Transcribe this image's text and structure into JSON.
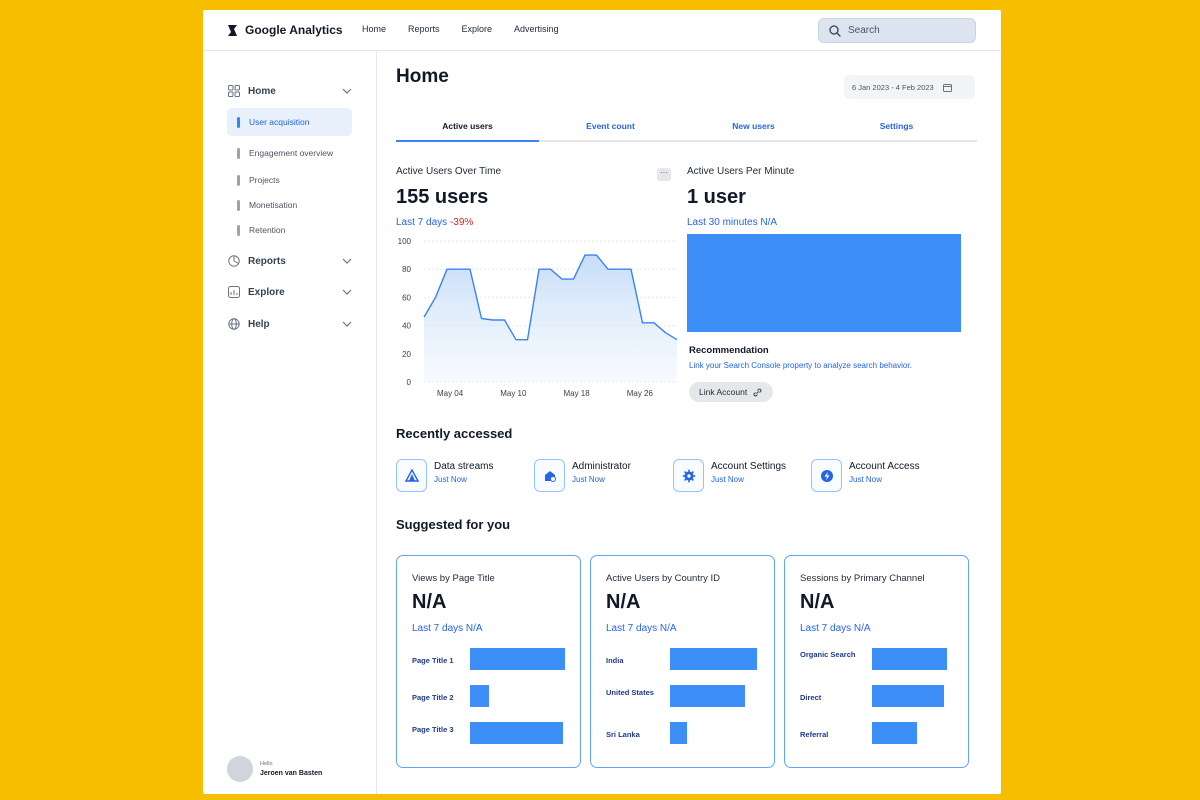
{
  "app": {
    "title": "Google Analytics"
  },
  "topnav": [
    "Home",
    "Reports",
    "Explore",
    "Advertising"
  ],
  "search": {
    "placeholder": "Search"
  },
  "sidebar": {
    "groups": [
      {
        "label": "Home",
        "icon": "grid-icon"
      },
      {
        "label": "Reports",
        "icon": "pie-chart-icon"
      },
      {
        "label": "Explore",
        "icon": "explore-chart-icon"
      },
      {
        "label": "Help",
        "icon": "globe-icon"
      }
    ],
    "home_items": [
      "User acquisition",
      "Engagement overview",
      "Projects",
      "Monetisation",
      "Retention"
    ],
    "user": {
      "greeting": "Hello",
      "name": "Jeroen van Basten"
    }
  },
  "page": {
    "title": "Home",
    "date_range": "6 Jan 2023 - 4 Feb 2023",
    "tabs": [
      "Active users",
      "Event count",
      "New users",
      "Settings"
    ]
  },
  "active_users": {
    "label": "Active Users Over Time",
    "value": "155 users",
    "period": "Last 7 days",
    "change": "-39%"
  },
  "per_minute": {
    "label": "Active Users Per Minute",
    "value": "1 user",
    "period": "Last 30 minutes N/A"
  },
  "recommendation": {
    "title": "Recommendation",
    "text": "Link your Search Console property to analyze search behavior.",
    "button": "Link Account"
  },
  "recently_accessed": {
    "title": "Recently accessed",
    "items": [
      {
        "name": "Data streams",
        "time": "Just Now",
        "icon": "data-streams-icon"
      },
      {
        "name": "Administrator",
        "time": "Just Now",
        "icon": "admin-icon"
      },
      {
        "name": "Account Settings",
        "time": "Just Now",
        "icon": "settings-gear-icon"
      },
      {
        "name": "Account Access",
        "time": "Just Now",
        "icon": "lightning-icon"
      }
    ]
  },
  "suggested": {
    "title": "Suggested for you",
    "cards": [
      {
        "title": "Views by Page Title",
        "value": "N/A",
        "sub": "Last 7 days N/A",
        "bars": [
          {
            "label": "Page Title 1",
            "value": 1.0
          },
          {
            "label": "Page Title 2",
            "value": 0.2
          },
          {
            "label": "Page Title 3",
            "value": 0.98
          }
        ]
      },
      {
        "title": "Active Users by Country ID",
        "value": "N/A",
        "sub": "Last 7 days N/A",
        "bars": [
          {
            "label": "India",
            "value": 1.0
          },
          {
            "label": "United States",
            "value": 0.86
          },
          {
            "label": "Sri Lanka",
            "value": 0.2
          }
        ]
      },
      {
        "title": "Sessions by Primary Channel",
        "value": "N/A",
        "sub": "Last 7 days N/A",
        "bars": [
          {
            "label": "Organic Search",
            "value": 1.0
          },
          {
            "label": "Direct",
            "value": 0.96
          },
          {
            "label": "Referral",
            "value": 0.6
          }
        ]
      }
    ]
  },
  "colors": {
    "accent": "#3D8EF7",
    "link": "#2563EB",
    "negative": "#DC2626",
    "background": "#F7BE00"
  },
  "chart_data": {
    "type": "area",
    "title": "Active Users Over Time",
    "x": [
      0,
      1,
      2,
      3,
      4,
      5,
      6,
      7,
      8,
      9,
      10,
      11,
      12,
      13,
      14,
      15,
      16,
      17,
      18,
      19,
      20,
      21,
      22,
      23,
      24
    ],
    "x_tick_labels": [
      "May 04",
      "May 10",
      "May 18",
      "May 26"
    ],
    "x_tick_positions": [
      2,
      8,
      14,
      20
    ],
    "values": [
      46,
      60,
      80,
      80,
      80,
      45,
      44,
      44,
      30,
      30,
      80,
      80,
      73,
      73,
      90,
      90,
      80,
      80,
      80,
      42,
      42,
      35,
      30
    ],
    "ylim": [
      0,
      100
    ],
    "y_ticks": [
      0,
      20,
      40,
      60,
      80,
      100
    ],
    "grid": true
  }
}
